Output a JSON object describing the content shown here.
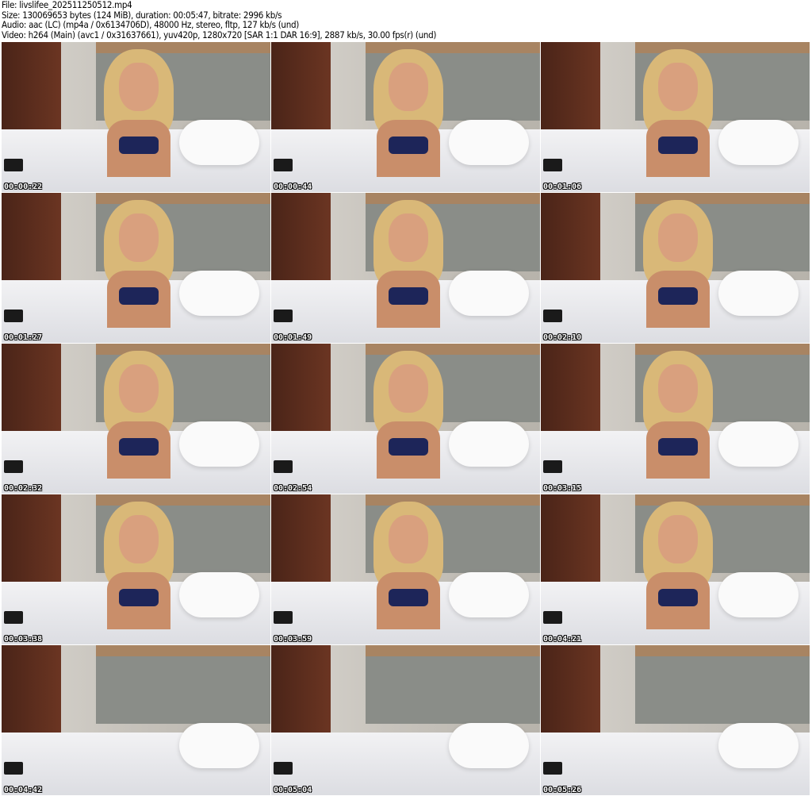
{
  "header": {
    "file": "File: livslifee_202511250512.mp4",
    "size": "Size: 130069653 bytes (124 MiB), duration: 00:05:47, bitrate: 2996 kb/s",
    "audio": "Audio: aac (LC) (mp4a / 0x6134706D), 48000 Hz, stereo, fltp, 127 kb/s (und)",
    "video": "Video: h264 (Main) (avc1 / 0x31637661), yuv420p, 1280x720 [SAR 1:1 DAR 16:9], 2887 kb/s, 30.00 fps(r) (und)"
  },
  "thumbnails": [
    {
      "time": "00:00:22",
      "person": true
    },
    {
      "time": "00:00:44",
      "person": true
    },
    {
      "time": "00:01:06",
      "person": true
    },
    {
      "time": "00:01:27",
      "person": true
    },
    {
      "time": "00:01:49",
      "person": true
    },
    {
      "time": "00:02:10",
      "person": true
    },
    {
      "time": "00:02:32",
      "person": true
    },
    {
      "time": "00:02:54",
      "person": true
    },
    {
      "time": "00:03:15",
      "person": true
    },
    {
      "time": "00:03:38",
      "person": true
    },
    {
      "time": "00:03:59",
      "person": true
    },
    {
      "time": "00:04:21",
      "person": true
    },
    {
      "time": "00:04:42",
      "person": false
    },
    {
      "time": "00:05:04",
      "person": false
    },
    {
      "time": "00:05:26",
      "person": false
    }
  ]
}
